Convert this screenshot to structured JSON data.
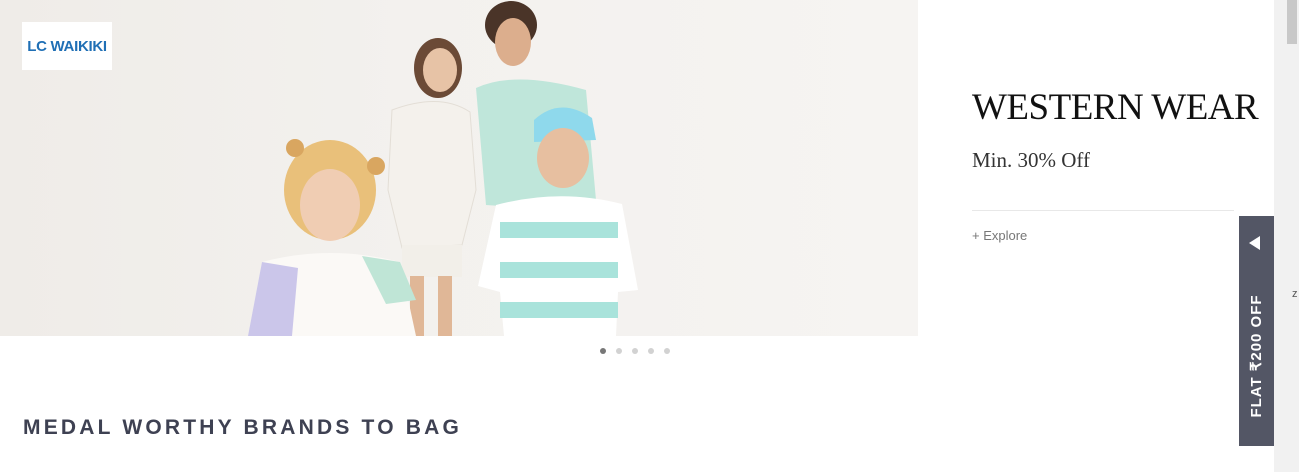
{
  "banner": {
    "brand_logo": "LC WAIKIKI",
    "slide_count": 5,
    "active_slide": 1
  },
  "promo": {
    "title": "WESTERN WEAR",
    "subtitle": "Min. 30% Off",
    "link": "+ Explore"
  },
  "section": {
    "title": "MEDAL WORTHY BRANDS TO BAG"
  },
  "offer_tab": {
    "label": "FLAT ₹200 OFF",
    "icon": "left-arrow-icon"
  },
  "scrollbar": {
    "glyph": "z"
  },
  "colors": {
    "heading": "#3e4152",
    "offer_tab_bg": "#535665",
    "logo_blue": "#1f6fb5"
  }
}
